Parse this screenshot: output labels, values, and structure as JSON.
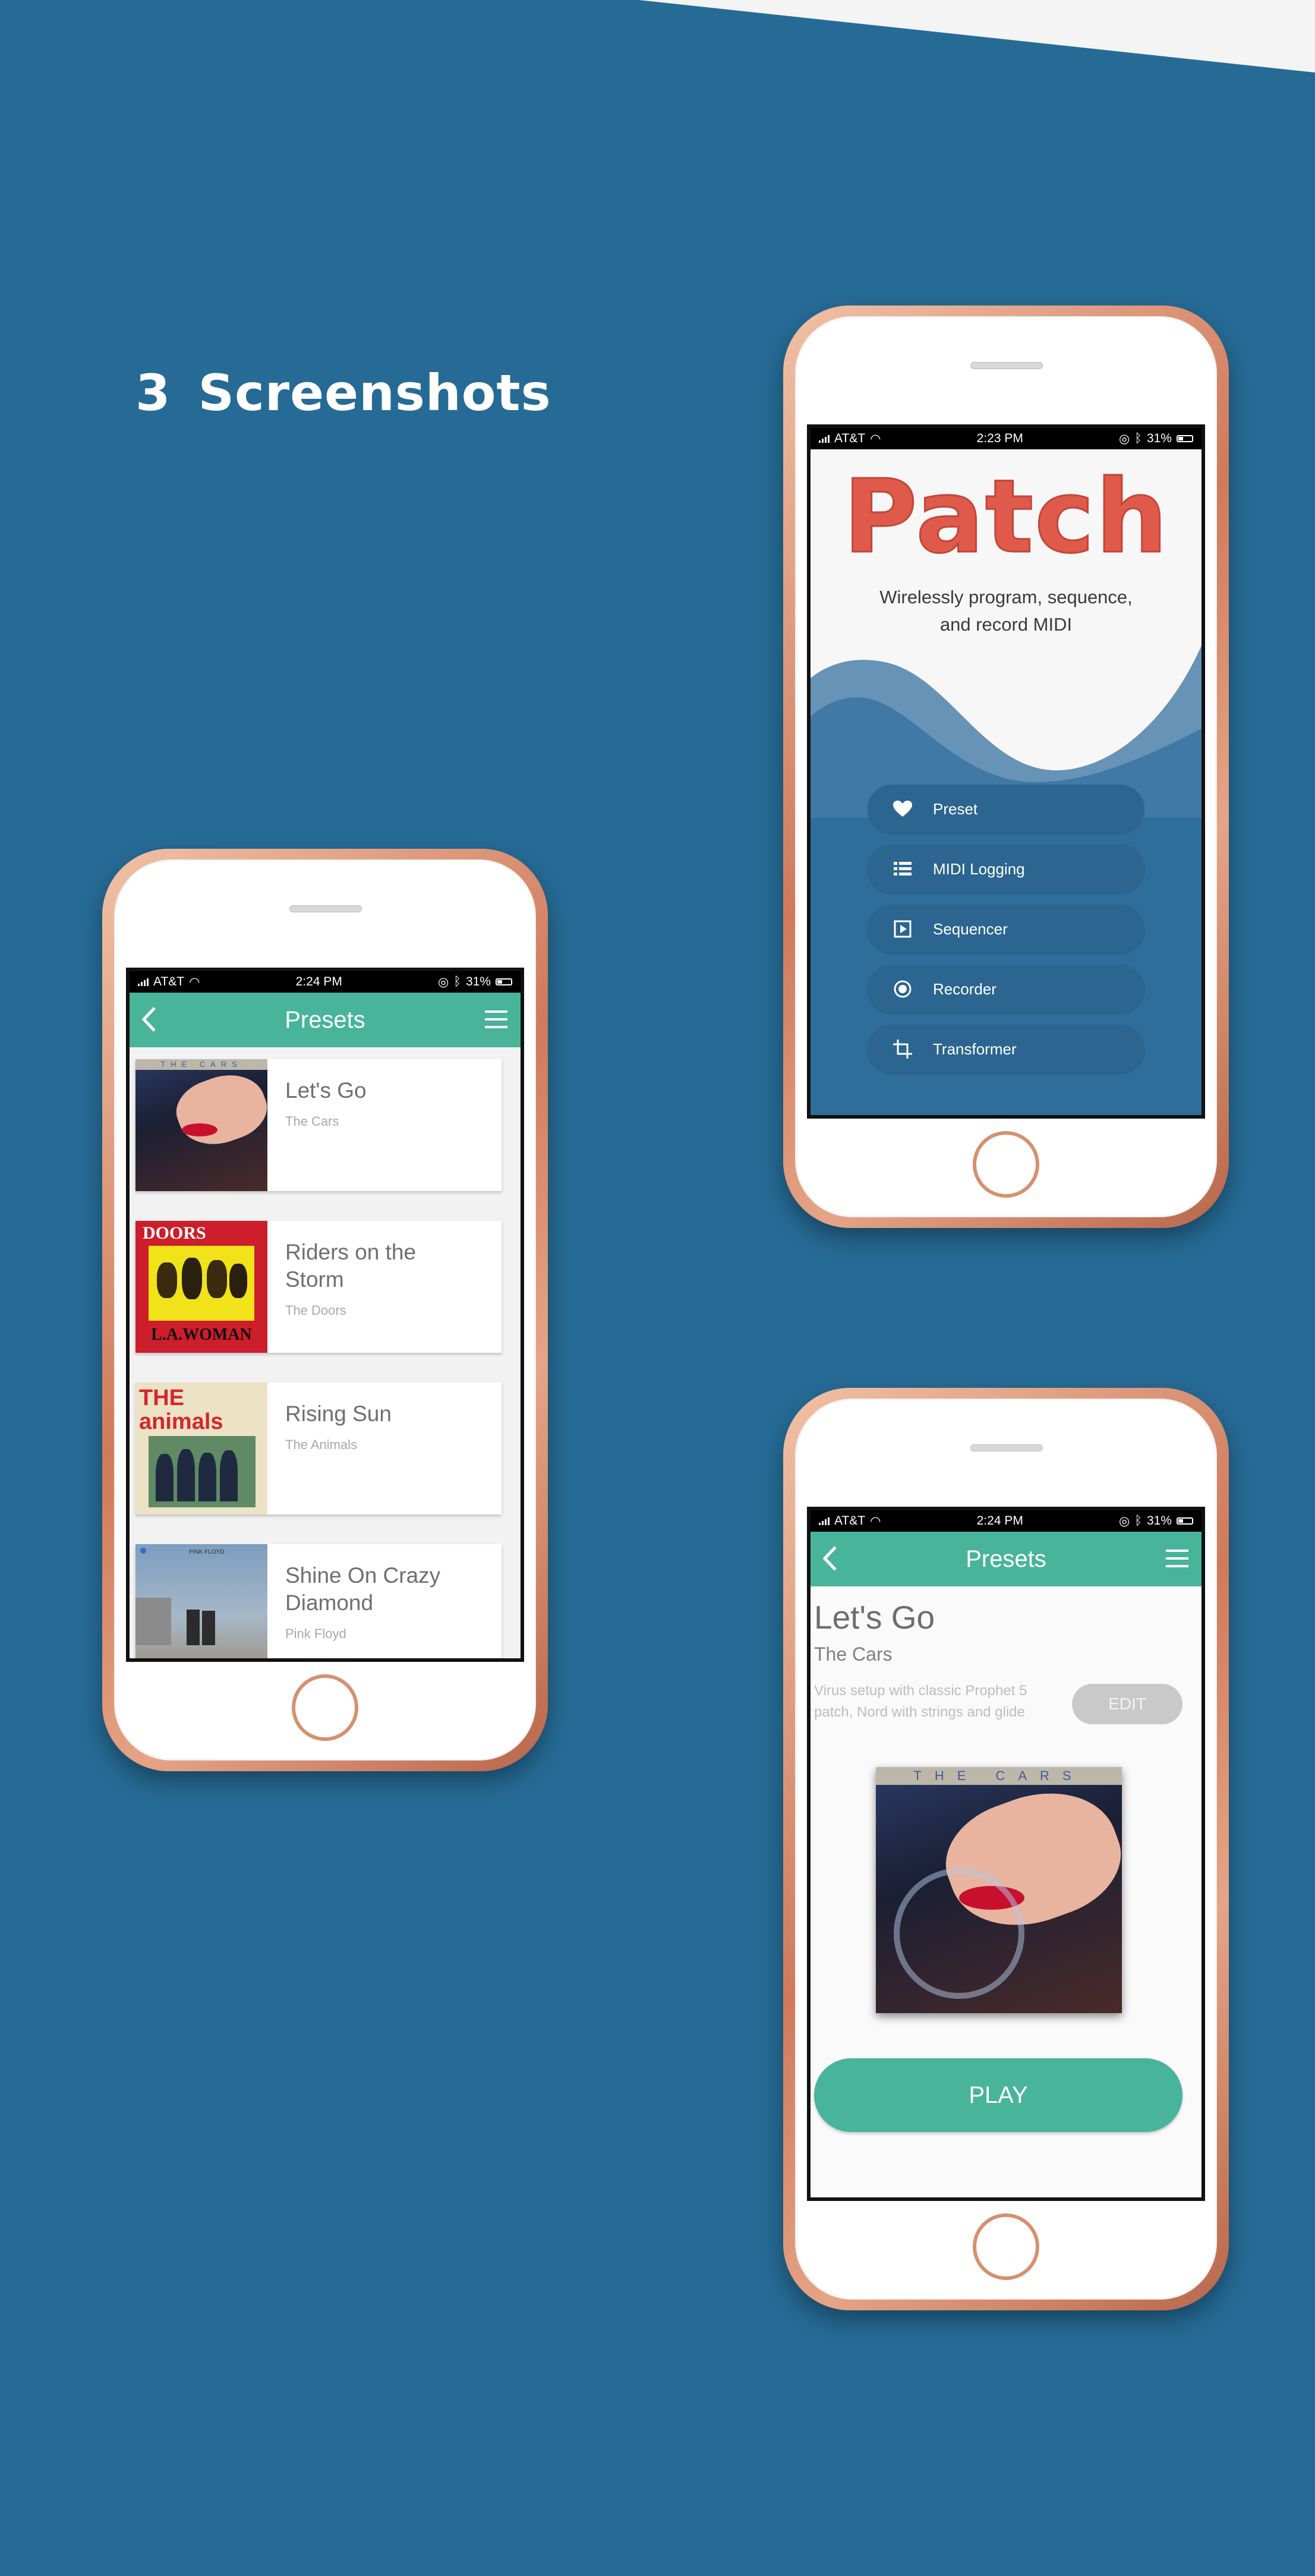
{
  "section": {
    "number": "3",
    "title": "Screenshots"
  },
  "phone_home": {
    "status": {
      "carrier": "AT&T",
      "time": "2:23 PM",
      "battery": "31%"
    },
    "logo": "Patch",
    "tagline_line1": "Wirelessly program, sequence,",
    "tagline_line2": "and record MIDI",
    "menu": [
      {
        "label": "Preset",
        "icon": "heart-icon"
      },
      {
        "label": "MIDI Logging",
        "icon": "list-icon"
      },
      {
        "label": "Sequencer",
        "icon": "play-box-icon"
      },
      {
        "label": "Recorder",
        "icon": "record-icon"
      },
      {
        "label": "Transformer",
        "icon": "crop-icon"
      }
    ]
  },
  "phone_list": {
    "status": {
      "carrier": "AT&T",
      "time": "2:24 PM",
      "battery": "31%"
    },
    "nav_title": "Presets",
    "presets": [
      {
        "title": "Let's Go",
        "artist": "The Cars",
        "cover_text": "THE CARS"
      },
      {
        "title": "Riders on the Storm",
        "artist": "The Doors",
        "cover_text_top": "DOORS",
        "cover_text_bottom": "L.A.WOMAN"
      },
      {
        "title": "Rising Sun",
        "artist": "The Animals",
        "cover_text": "THE animals"
      },
      {
        "title": "Shine On Crazy Diamond",
        "artist": "Pink Floyd",
        "cover_text": "PINK FLOYD"
      }
    ]
  },
  "phone_detail": {
    "status": {
      "carrier": "AT&T",
      "time": "2:24 PM",
      "battery": "31%"
    },
    "nav_title": "Presets",
    "title": "Let's Go",
    "artist": "The Cars",
    "description": "Virus setup with classic Prophet 5 patch, Nord with strings and glide",
    "edit_label": "EDIT",
    "cover_text": "THE CARS",
    "play_label": "PLAY"
  },
  "colors": {
    "background": "#266b96",
    "accent": "#48b49a",
    "logo": "#e05a4b"
  }
}
